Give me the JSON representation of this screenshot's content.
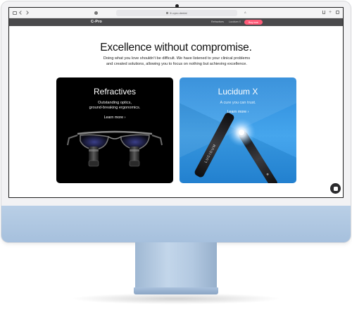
{
  "browser": {
    "address": "lh.cpro.dental"
  },
  "site_nav": {
    "logo": "C-Pro",
    "links": [
      "Refractives",
      "Lucidum X"
    ],
    "cta": "Buy now"
  },
  "hero": {
    "headline": "Excellence without compromise.",
    "subtext_line1": "Doing what you love shouldn't be difficult. We have listened to your clinical problems",
    "subtext_line2": "and created solutions, allowing you to focus on nothing but achieving excellence."
  },
  "cards": [
    {
      "title": "Refractives",
      "subtitle_line1": "Outstanding optics,",
      "subtitle_line2": "ground-breaking ergonomics.",
      "link": "Learn more ›",
      "background": "#000000"
    },
    {
      "title": "Lucidum X",
      "subtitle_line1": "A cure you can trust.",
      "link": "Learn more ›",
      "background": "#2a8fe2",
      "device_text": "LUCIDUM"
    }
  ],
  "chat": {
    "icon": "chat-icon"
  },
  "colors": {
    "nav_bg": "#4a4a4c",
    "cta": "#ff5b78",
    "chin": "#b3c9e1"
  }
}
